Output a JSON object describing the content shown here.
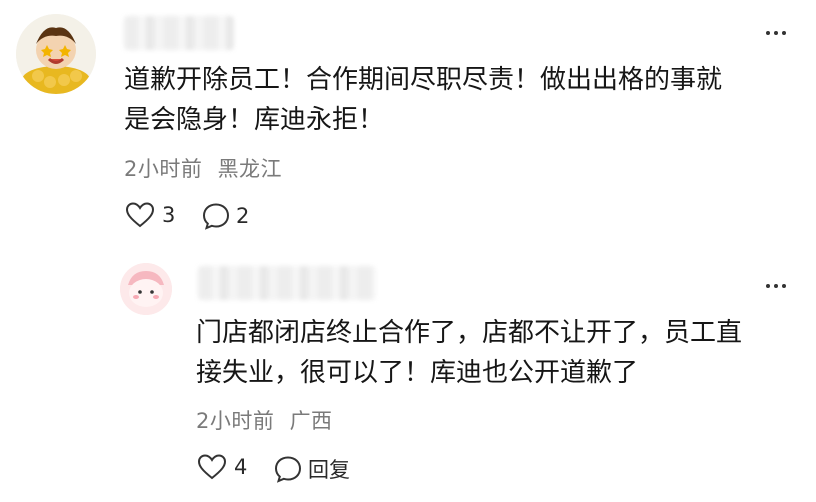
{
  "comments": [
    {
      "text_line1": "道歉开除员工！合作期间尽职尽责！做出出格的事就",
      "text_line2": "是会隐身！库迪永拒！",
      "time": "2小时前",
      "location": "黑龙江",
      "likes": "3",
      "replies": "2"
    },
    {
      "text_line1": "门店都闭店终止合作了，店都不让开了，员工直",
      "text_line2": "接失业，很可以了！库迪也公开道歉了",
      "time": "2小时前",
      "location": "广西",
      "likes": "4",
      "reply_label": "回复"
    }
  ]
}
